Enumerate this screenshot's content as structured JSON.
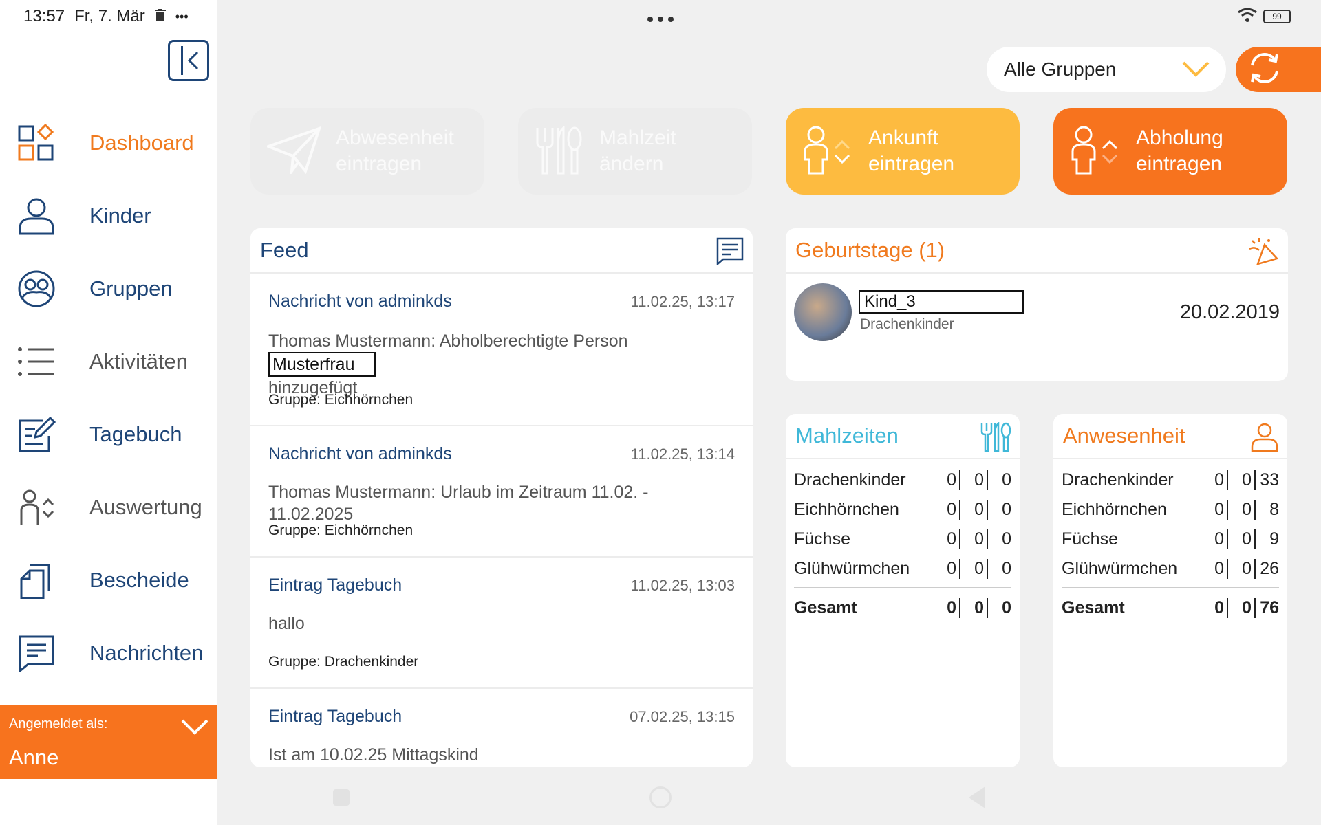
{
  "status": {
    "time": "13:57",
    "date": "Fr, 7. Mär",
    "battery": "99",
    "more": "•••"
  },
  "nav": [
    {
      "label": "Dashboard",
      "icon": "dashboard-icon"
    },
    {
      "label": "Kinder",
      "icon": "person-icon"
    },
    {
      "label": "Gruppen",
      "icon": "group-icon"
    },
    {
      "label": "Aktivitäten",
      "icon": "list-icon"
    },
    {
      "label": "Tagebuch",
      "icon": "diary-icon"
    },
    {
      "label": "Auswertung",
      "icon": "evaluation-icon"
    },
    {
      "label": "Bescheide",
      "icon": "documents-icon"
    },
    {
      "label": "Nachrichten",
      "icon": "message-icon"
    }
  ],
  "login": {
    "caption": "Angemeldet als:",
    "user": "Anne"
  },
  "group_select": {
    "value": "Alle Gruppen"
  },
  "actions": {
    "absence": {
      "line1": "Abwesenheit",
      "line2": "eintragen"
    },
    "meal": {
      "line1": "Mahlzeit",
      "line2": "ändern"
    },
    "arrival": {
      "line1": "Ankunft",
      "line2": "eintragen"
    },
    "pickup": {
      "line1": "Abholung",
      "line2": "eintragen"
    }
  },
  "feed": {
    "title": "Feed",
    "items": [
      {
        "title": "Nachricht von adminkds",
        "date": "11.02.25, 13:17",
        "body_prefix": "Thomas Mustermann: Abholberechtigte Person",
        "masked": "Musterfrau",
        "body_suffix": "hinzugefügt",
        "group": "Gruppe: Eichhörnchen"
      },
      {
        "title": "Nachricht von adminkds",
        "date": "11.02.25, 13:14",
        "body": "Thomas Mustermann: Urlaub im Zeitraum 11.02. - 11.02.2025",
        "group": "Gruppe: Eichhörnchen"
      },
      {
        "title": "Eintrag Tagebuch",
        "date": "11.02.25, 13:03",
        "body": "hallo",
        "group": "Gruppe: Drachenkinder"
      },
      {
        "title": "Eintrag Tagebuch",
        "date": "07.02.25, 13:15",
        "body": "Ist am 10.02.25 Mittagskind"
      }
    ]
  },
  "birthdays": {
    "title": "Geburtstage (1)",
    "child": {
      "name": "Kind_3",
      "group": "Drachenkinder",
      "date": "20.02.2019"
    }
  },
  "meals": {
    "title": "Mahlzeiten",
    "rows": [
      {
        "name": "Drachenkinder",
        "a": "0",
        "b": "0",
        "c": "0"
      },
      {
        "name": "Eichhörnchen",
        "a": "0",
        "b": "0",
        "c": "0"
      },
      {
        "name": "Füchse",
        "a": "0",
        "b": "0",
        "c": "0"
      },
      {
        "name": "Glühwürmchen",
        "a": "0",
        "b": "0",
        "c": "0"
      }
    ],
    "total": {
      "name": "Gesamt",
      "a": "0",
      "b": "0",
      "c": "0"
    }
  },
  "presence": {
    "title": "Anwesenheit",
    "rows": [
      {
        "name": "Drachenkinder",
        "a": "0",
        "b": "0",
        "c": "33"
      },
      {
        "name": "Eichhörnchen",
        "a": "0",
        "b": "0",
        "c": "8"
      },
      {
        "name": "Füchse",
        "a": "0",
        "b": "0",
        "c": "9"
      },
      {
        "name": "Glühwürmchen",
        "a": "0",
        "b": "0",
        "c": "26"
      }
    ],
    "total": {
      "name": "Gesamt",
      "a": "0",
      "b": "0",
      "c": "76"
    }
  },
  "colors": {
    "accent": "#f7731e",
    "navy": "#1e4577",
    "yellow": "#fdbb40",
    "cyan": "#40b8d8"
  }
}
